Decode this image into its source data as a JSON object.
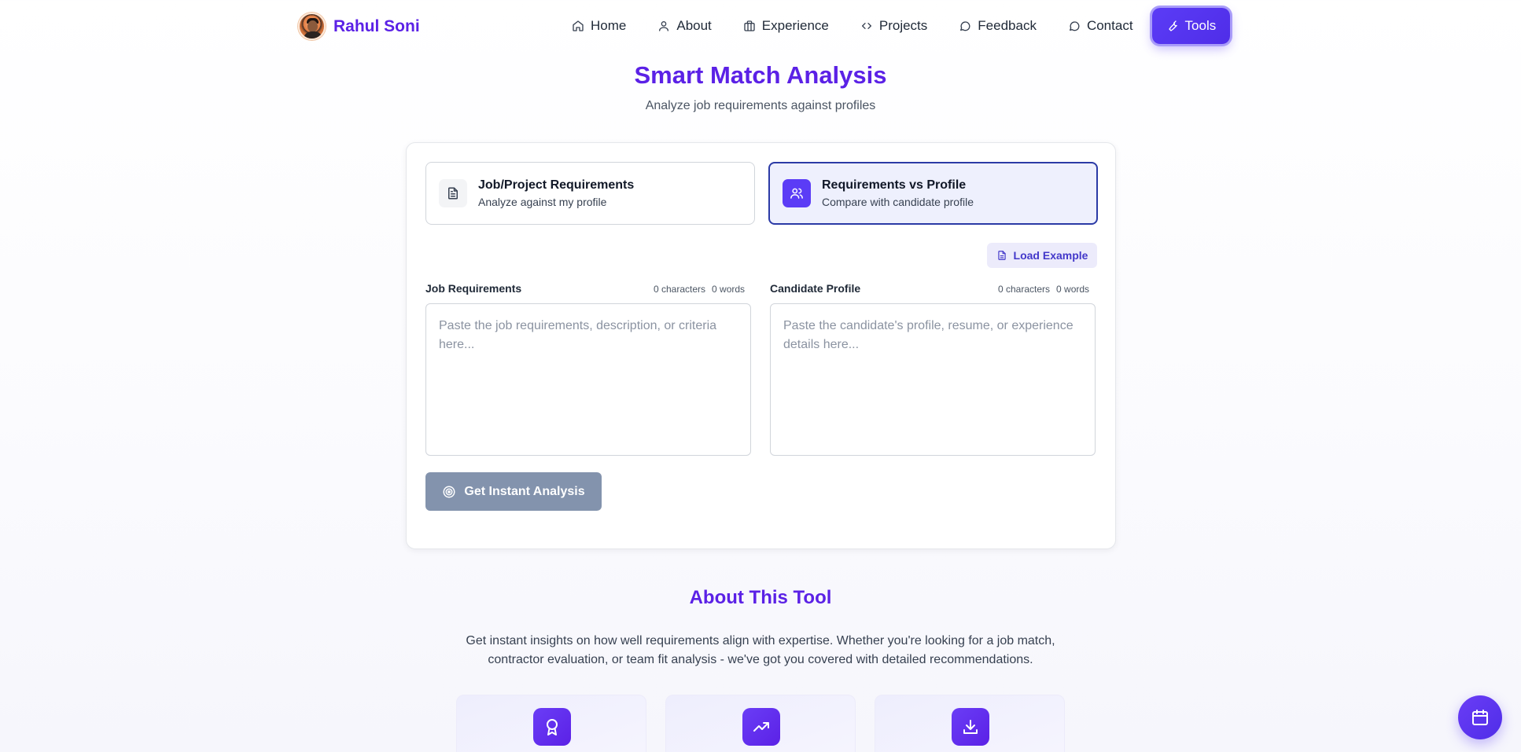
{
  "brand": {
    "name": "Rahul Soni"
  },
  "nav": {
    "items": [
      {
        "label": "Home",
        "icon": "home-icon"
      },
      {
        "label": "About",
        "icon": "user-icon"
      },
      {
        "label": "Experience",
        "icon": "briefcase-icon"
      },
      {
        "label": "Projects",
        "icon": "code-icon"
      },
      {
        "label": "Feedback",
        "icon": "message-icon"
      },
      {
        "label": "Contact",
        "icon": "message-icon"
      },
      {
        "label": "Tools",
        "icon": "wrench-icon",
        "active": true
      }
    ]
  },
  "header": {
    "title": "Smart Match Analysis",
    "subtitle": "Analyze job requirements against profiles"
  },
  "modes": [
    {
      "title": "Job/Project Requirements",
      "desc": "Analyze against my profile",
      "icon": "document-icon",
      "selected": false
    },
    {
      "title": "Requirements vs Profile",
      "desc": "Compare with candidate profile",
      "icon": "users-icon",
      "selected": true
    }
  ],
  "load_example": "Load Example",
  "fields": {
    "job": {
      "label": "Job Requirements",
      "chars": "0 characters",
      "words": "0 words",
      "value": "",
      "placeholder": "Paste the job requirements, description, or criteria here..."
    },
    "candidate": {
      "label": "Candidate Profile",
      "chars": "0 characters",
      "words": "0 words",
      "value": "",
      "placeholder": "Paste the candidate's profile, resume, or experience details here..."
    }
  },
  "analyze_button": "Get Instant Analysis",
  "about": {
    "title": "About This Tool",
    "text": "Get instant insights on how well requirements align with expertise. Whether you're looking for a job match, contractor evaluation, or team fit analysis - we've got you covered with detailed recommendations."
  },
  "features": [
    {
      "icon": "award-icon"
    },
    {
      "icon": "trending-up-icon"
    },
    {
      "icon": "download-icon"
    }
  ],
  "fab": {
    "icon": "calendar-icon"
  },
  "colors": {
    "accent": "#5b21e6",
    "primary_button": "#5b3cf6",
    "disabled_button": "#8393ad",
    "selected_border": "#2b3aa6"
  }
}
